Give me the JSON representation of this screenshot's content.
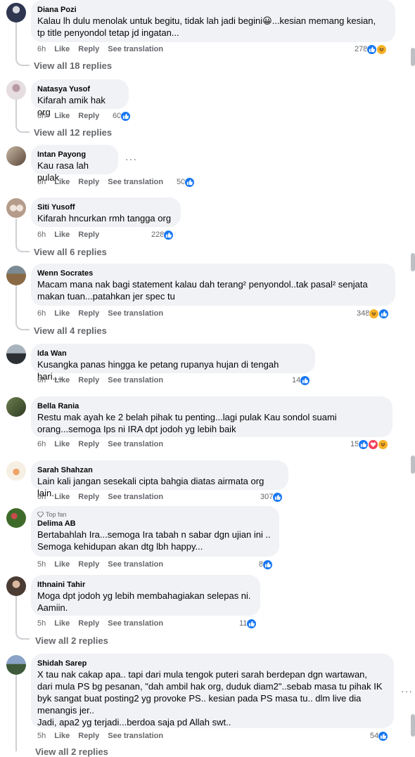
{
  "labels": {
    "like": "Like",
    "reply": "Reply",
    "see_translation": "See translation",
    "top_fan": "Top fan",
    "more": "···"
  },
  "comments": [
    {
      "author": "Diana Pozi",
      "text": "Kalau lh dulu menolak untuk begitu, tidak lah jadi begini😀...kesian memang kesian,\ntp title penyondol tetap jd ingatan...",
      "time": "6h",
      "count": "278",
      "reactions": [
        "like",
        "haha"
      ],
      "translation": true,
      "replies": "View all 18 replies"
    },
    {
      "author": "Natasya Yusof",
      "text": "Kifarah amik hak org",
      "time": "6h",
      "count": "60",
      "reactions": [
        "like"
      ],
      "translation": false,
      "replies": "View all 12 replies"
    },
    {
      "author": "Intan Payong",
      "text": "Kau rasa lah pulak",
      "time": "6h",
      "count": "50",
      "reactions": [
        "like"
      ],
      "translation": true,
      "replies": ""
    },
    {
      "author": "Siti Yusoff",
      "text": "Kifarah hncurkan rmh tangga org",
      "time": "6h",
      "count": "228",
      "reactions": [
        "like"
      ],
      "translation": false,
      "replies": "View all 6 replies"
    },
    {
      "author": "Wenn Socrates",
      "text": "Macam mana nak bagi statement kalau dah terang² penyondol..tak pasal² senjata\nmakan tuan...patahkan jer spec tu",
      "time": "6h",
      "count": "348",
      "reactions": [
        "haha",
        "like"
      ],
      "translation": true,
      "replies": "View all 4 replies"
    },
    {
      "author": "Ida Wan",
      "text": "Kusangka panas hingga ke petang rupanya hujan di tengah hari....",
      "time": "6h",
      "count": "14",
      "reactions": [
        "like"
      ],
      "translation": true,
      "replies": ""
    },
    {
      "author": "Bella Rania",
      "text": "Restu mak ayah ke 2 belah pihak tu penting...lagi pulak Kau sondol suami\norang...semoga Ips ni IRA dpt jodoh yg lebih baik",
      "time": "6h",
      "count": "15",
      "reactions": [
        "like",
        "love",
        "haha"
      ],
      "translation": true,
      "replies": ""
    },
    {
      "author": "Sarah Shahzan",
      "text": "Lain kali jangan sesekali cipta bahgia diatas airmata org lain.",
      "time": "6h",
      "count": "307",
      "reactions": [
        "like"
      ],
      "translation": true,
      "replies": ""
    },
    {
      "author": "Delima AB",
      "text": "Bertabahlah Ira...semoga Ira tabah n sabar dgn ujian ini ..\nSemoga kehidupan akan dtg lbh happy...",
      "time": "5h",
      "count": "8",
      "reactions": [
        "like"
      ],
      "translation": true,
      "replies": "",
      "top_fan": true
    },
    {
      "author": "Ithnaini Tahir",
      "text": "Moga dpt jodoh yg lebih membahagiakan selepas ni.\nAamiin.",
      "time": "5h",
      "count": "11",
      "reactions": [
        "like"
      ],
      "translation": true,
      "replies": "View all 2 replies"
    },
    {
      "author": "Shidah Sarep",
      "text": "X tau nak cakap apa.. tapi dari mula tengok puteri sarah berdepan dgn wartawan,\ndari mula PS bg pesanan, \"dah ambil hak org, duduk diam2\"..sebab masa tu pihak IK\nbyk sangat buat posting2 yg provoke PS.. kesian pada PS masa tu.. dlm live dia\nmenangis jer..\nJadi, apa2 yg terjadi...berdoa saja pd Allah swt..",
      "time": "5h",
      "count": "54",
      "reactions": [
        "like"
      ],
      "translation": true,
      "replies": "View all 2 replies"
    }
  ],
  "colors": {
    "like": "#1877f2",
    "love": "#f33e58",
    "haha": "#f7b125",
    "bubble": "#f0f2f5",
    "muted": "#65676b"
  }
}
